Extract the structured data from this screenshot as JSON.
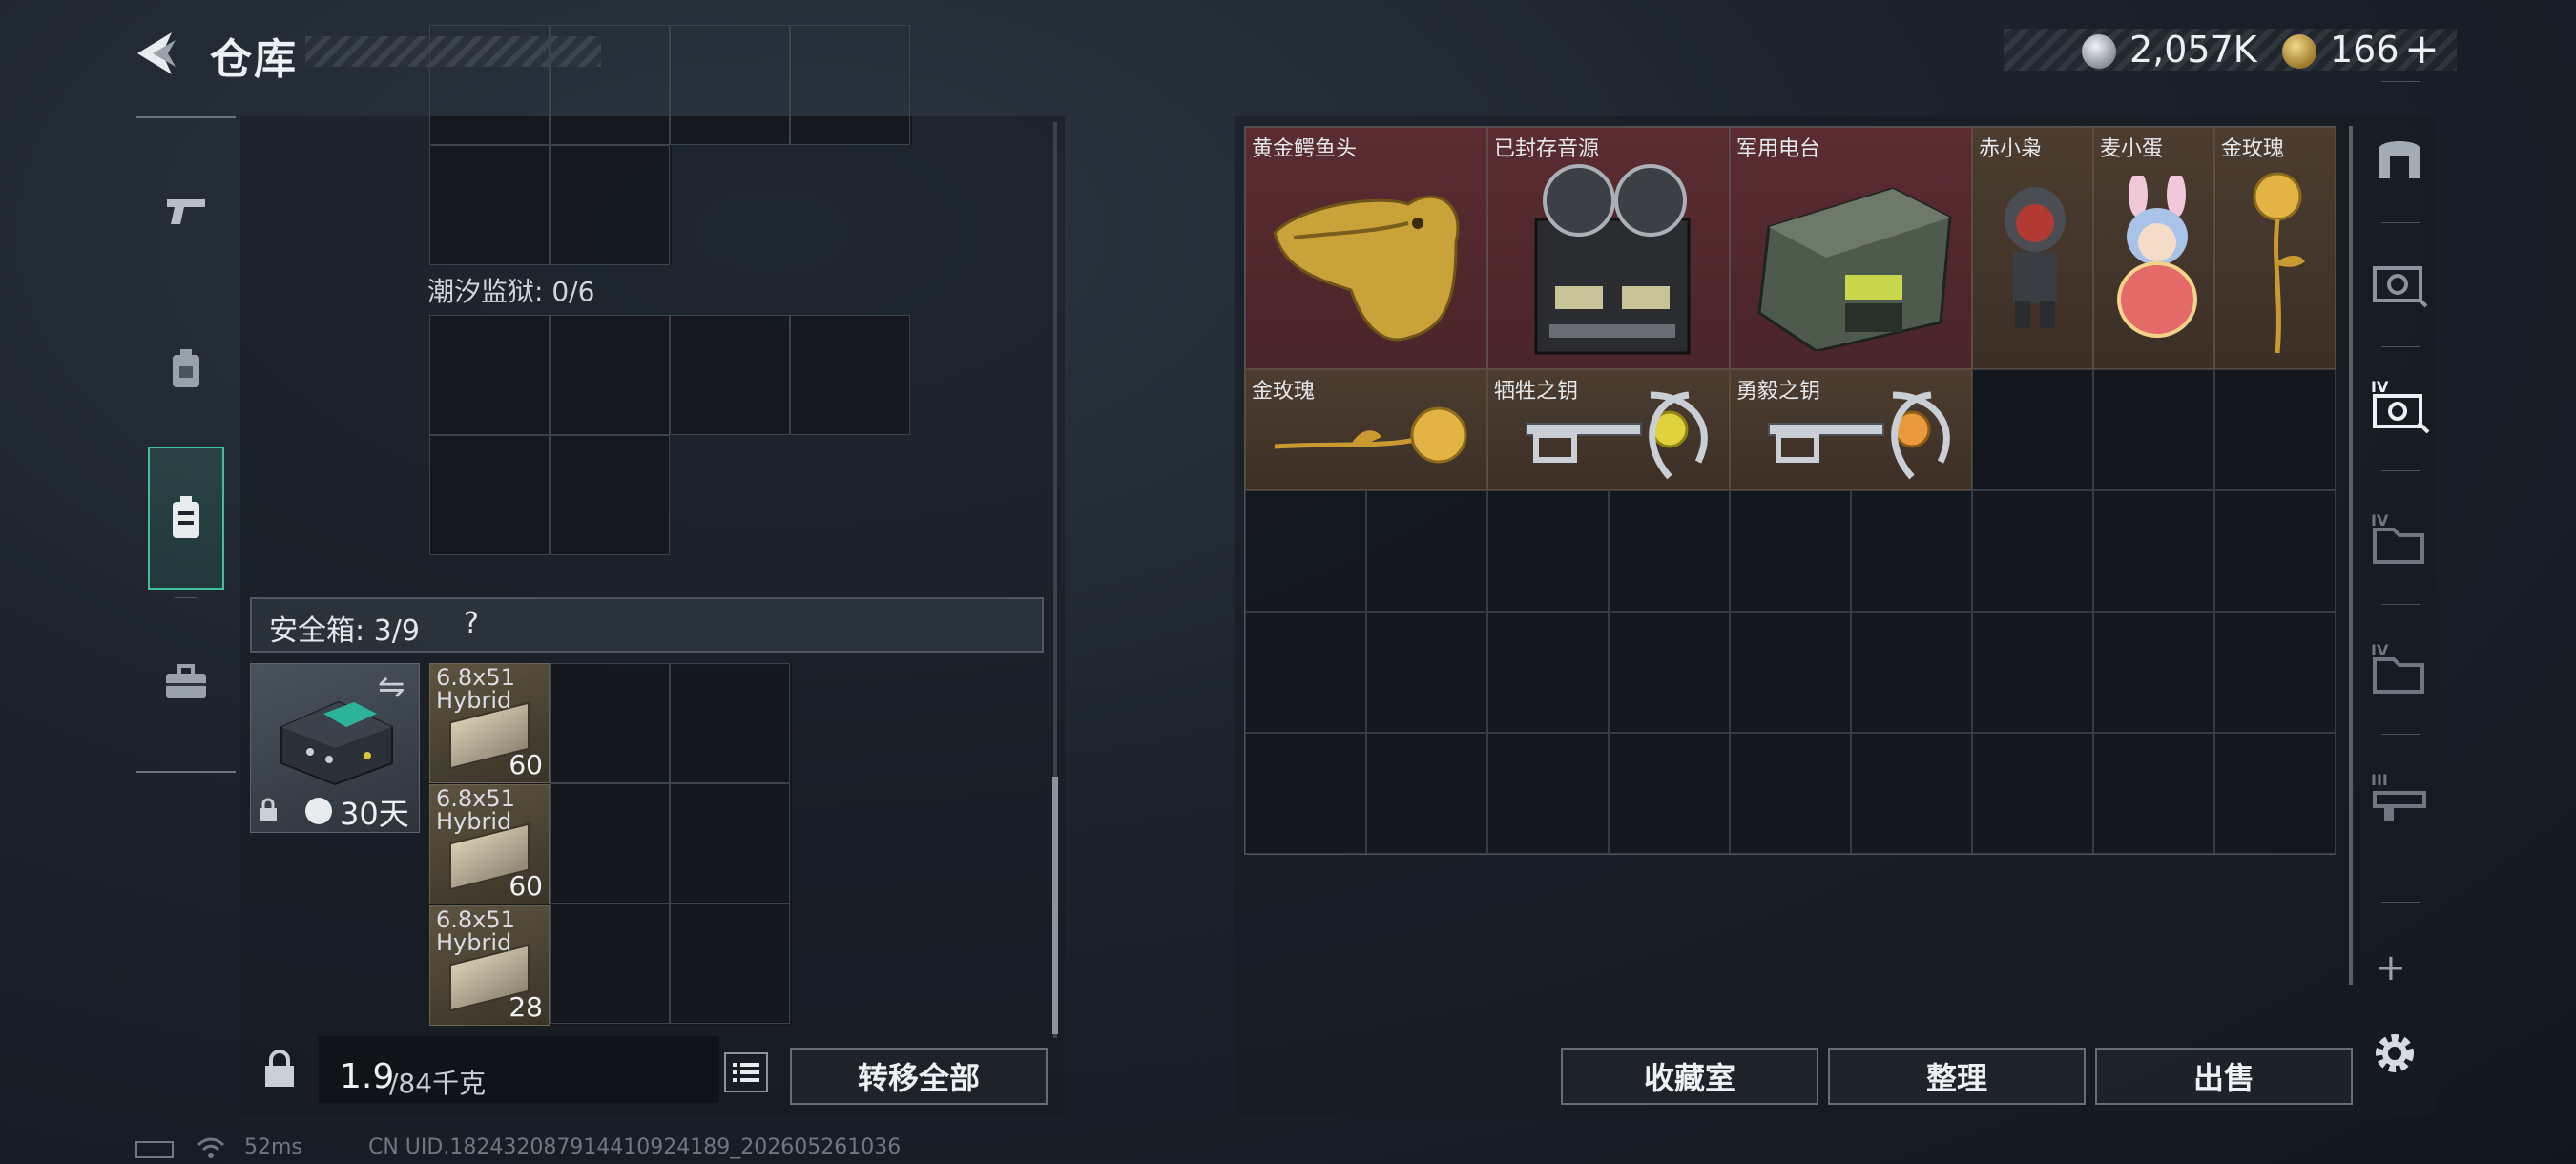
{
  "header": {
    "title": "仓库",
    "currency_1": "2,057K",
    "currency_2": "166",
    "currency_2_plus": "+"
  },
  "left": {
    "tidal_prison_label": "潮汐监狱: 0/6",
    "safebox_label": "安全箱: 3/9",
    "safebox_help": "?",
    "safebox_days": "30天",
    "ammo": [
      {
        "name": "6.8x51\nHybrid",
        "count": "60"
      },
      {
        "name": "6.8x51\nHybrid",
        "count": "60"
      },
      {
        "name": "6.8x51\nHybrid",
        "count": "28"
      }
    ],
    "weight_value": "1.9",
    "weight_max": "/84千克",
    "transfer_all": "转移全部"
  },
  "stash": {
    "items": [
      {
        "name": "黄金鳄鱼头",
        "rarity": "red"
      },
      {
        "name": "已封存音源",
        "rarity": "red"
      },
      {
        "name": "军用电台",
        "rarity": "red"
      },
      {
        "name": "赤小枭",
        "rarity": "gold"
      },
      {
        "name": "麦小蛋",
        "rarity": "gold"
      },
      {
        "name": "金玫瑰",
        "rarity": "gold"
      },
      {
        "name": "金玫瑰",
        "rarity": "gold"
      },
      {
        "name": "牺牲之钥",
        "rarity": "gold"
      },
      {
        "name": "勇毅之钥",
        "rarity": "gold"
      }
    ]
  },
  "buttons": {
    "collection": "收藏室",
    "organize": "整理",
    "sell": "出售"
  },
  "status": {
    "ping": "52ms",
    "uid": "CN UID.1824320879144109241​89_202605261036"
  },
  "colors": {
    "accent_green": "#3fbf9a",
    "rarity_red": "#5a2c31",
    "rarity_gold": "#4d3d30"
  }
}
